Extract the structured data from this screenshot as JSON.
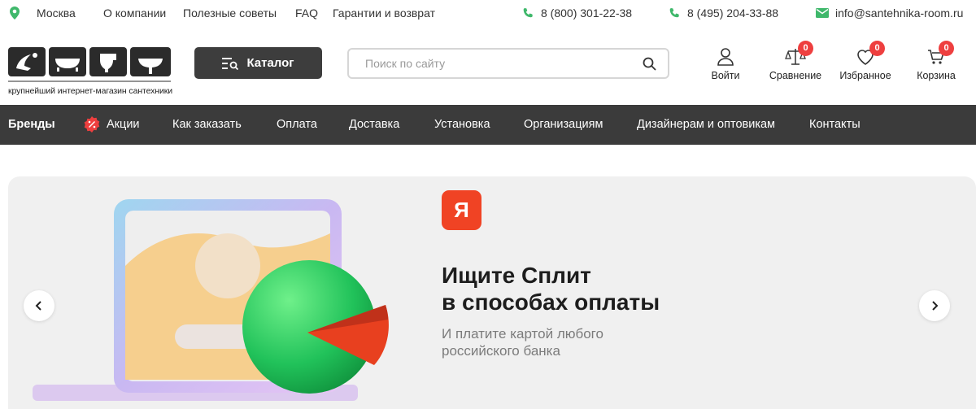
{
  "topbar": {
    "city": "Москва",
    "links": [
      "О компании",
      "Полезные советы",
      "FAQ",
      "Гарантии и возврат"
    ],
    "phone1": "8 (800) 301-22-38",
    "phone2": "8 (495) 204-33-88",
    "email": "info@santehnika-room.ru"
  },
  "header": {
    "logo_tagline": "крупнейший интернет-магазин сантехники",
    "catalog_label": "Каталог",
    "search_placeholder": "Поиск по сайту",
    "login_label": "Войти",
    "compare_label": "Сравнение",
    "compare_count": "0",
    "favorites_label": "Избранное",
    "favorites_count": "0",
    "cart_label": "Корзина",
    "cart_count": "0"
  },
  "nav": {
    "items": [
      "Бренды",
      "Акции",
      "Как заказать",
      "Оплата",
      "Доставка",
      "Установка",
      "Организациям",
      "Дизайнерам и оптовикам",
      "Контакты"
    ]
  },
  "banner": {
    "logo_letter": "Я",
    "heading_line1": "Ищите Сплит",
    "heading_line2": "в способах оплаты",
    "sub_line1": "И платите картой любого",
    "sub_line2": "российского банка"
  },
  "colors": {
    "accent_green": "#3fb86b",
    "nav_bg": "#3b3b3b",
    "badge_red": "#ee3f3f",
    "yandex_red": "#f04324"
  },
  "icons": [
    "map-pin-icon",
    "phone-icon",
    "mail-icon",
    "catalog-icon",
    "search-icon",
    "user-icon",
    "scales-icon",
    "heart-icon",
    "cart-icon",
    "percent-icon",
    "chevron-left-icon",
    "chevron-right-icon"
  ]
}
